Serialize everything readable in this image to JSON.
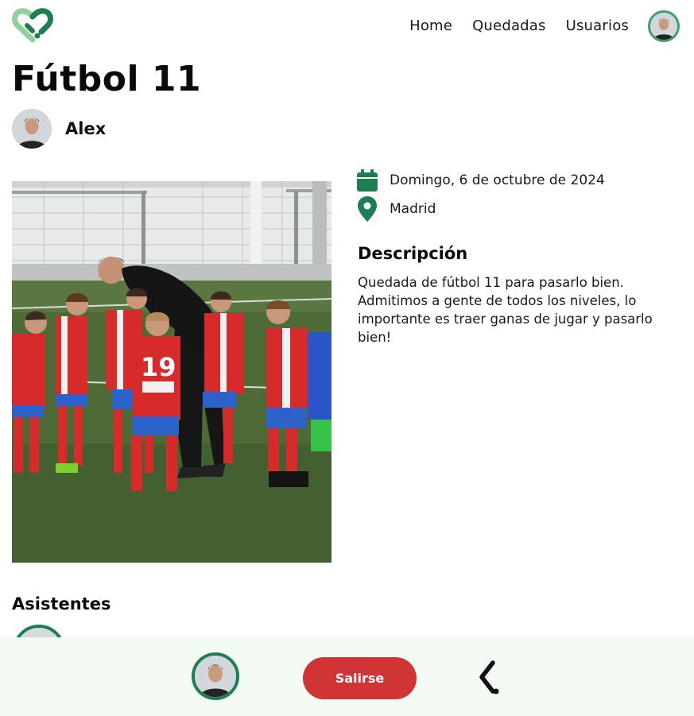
{
  "nav": {
    "links": [
      "Home",
      "Quedadas",
      "Usuarios"
    ]
  },
  "event": {
    "title": "Fútbol 11",
    "organizer": "Alex",
    "date": "Domingo, 6 de octubre de 2024",
    "location": "Madrid",
    "description_title": "Descripción",
    "description": "Quedada de fútbol 11 para pasarlo bien. Admitimos a gente de todos los niveles, lo importante es traer ganas de jugar y pasarlo bien!"
  },
  "attendees": {
    "title": "Asistentes"
  },
  "actions": {
    "leave_label": "Salirse"
  },
  "icons": {
    "logo": "heart-logo-icon",
    "date": "calendar-icon",
    "location": "map-pin-icon",
    "back": "chevron-left-icon"
  },
  "colors": {
    "accent_green": "#1e7d52",
    "leave_red": "#d03434",
    "bottom_bar_bg": "#f4fbf4"
  }
}
